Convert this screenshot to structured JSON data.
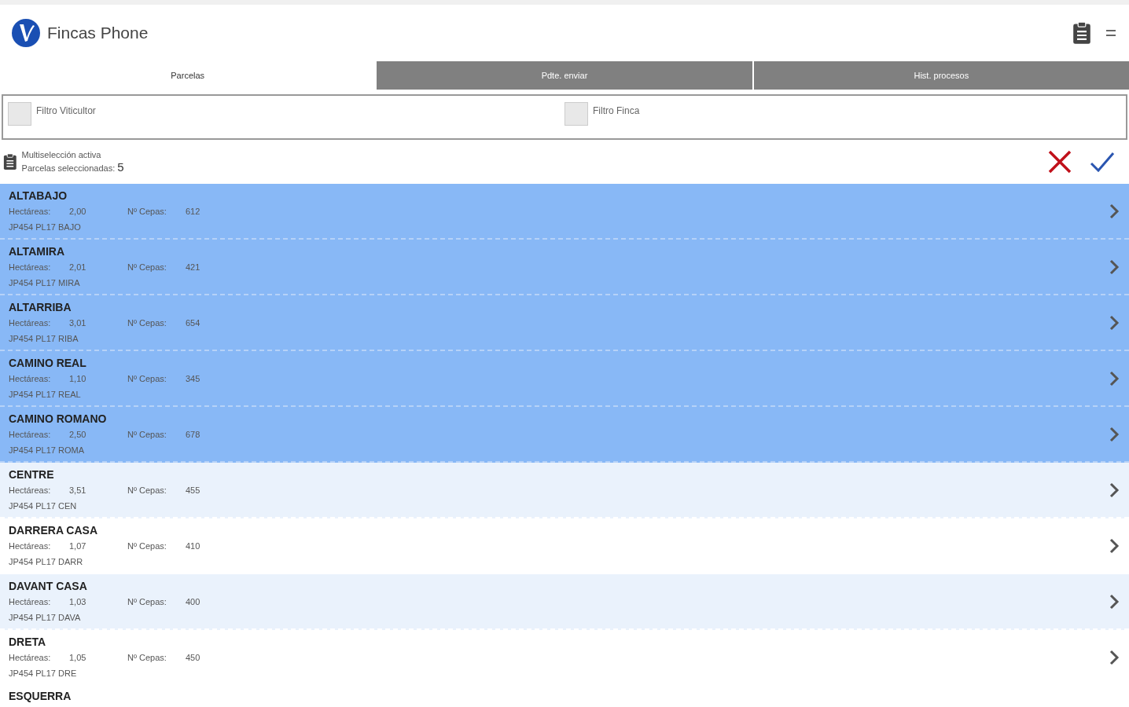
{
  "app": {
    "title": "Fincas Phone"
  },
  "tabs": [
    {
      "label": "Parcelas",
      "selected": true
    },
    {
      "label": "Pdte. enviar",
      "selected": false
    },
    {
      "label": "Hist. procesos",
      "selected": false
    }
  ],
  "filters": [
    {
      "label": "Filtro Viticultor",
      "checked": false
    },
    {
      "label": "Filtro Finca",
      "checked": false
    }
  ],
  "selection_bar": {
    "line_1": "Multiselección activa",
    "label": "Parcelas seleccionadas:",
    "count": "5"
  },
  "parcels": [
    {
      "name": "ALTABAJO",
      "hectares_label": "Hectáreas:",
      "hectares": "2,00",
      "vines_label": "Nº Cepas:",
      "vines": "612",
      "code": "JP454 PL17 BAJO",
      "selected": true
    },
    {
      "name": "ALTAMIRA",
      "hectares_label": "Hectáreas:",
      "hectares": "2,01",
      "vines_label": "Nº Cepas:",
      "vines": "421",
      "code": "JP454 PL17 MIRA",
      "selected": true
    },
    {
      "name": "ALTARRIBA",
      "hectares_label": "Hectáreas:",
      "hectares": "3,01",
      "vines_label": "Nº Cepas:",
      "vines": "654",
      "code": "JP454 PL17 RIBA",
      "selected": true
    },
    {
      "name": "CAMINO REAL",
      "hectares_label": "Hectáreas:",
      "hectares": "1,10",
      "vines_label": "Nº Cepas:",
      "vines": "345",
      "code": "JP454 PL17 REAL",
      "selected": true
    },
    {
      "name": "CAMINO ROMANO",
      "hectares_label": "Hectáreas:",
      "hectares": "2,50",
      "vines_label": "Nº Cepas:",
      "vines": "678",
      "code": "JP454 PL17 ROMA",
      "selected": true
    },
    {
      "name": "CENTRE",
      "hectares_label": "Hectáreas:",
      "hectares": "3,51",
      "vines_label": "Nº Cepas:",
      "vines": "455",
      "code": "JP454 PL17 CEN",
      "selected": false
    },
    {
      "name": "DARRERA CASA",
      "hectares_label": "Hectáreas:",
      "hectares": "1,07",
      "vines_label": "Nº Cepas:",
      "vines": "410",
      "code": "JP454 PL17 DARR",
      "selected": false
    },
    {
      "name": "DAVANT CASA",
      "hectares_label": "Hectáreas:",
      "hectares": "1,03",
      "vines_label": "Nº Cepas:",
      "vines": "400",
      "code": "JP454 PL17 DAVA",
      "selected": false
    },
    {
      "name": "DRETA",
      "hectares_label": "Hectáreas:",
      "hectares": "1,05",
      "vines_label": "Nº Cepas:",
      "vines": "450",
      "code": "JP454 PL17 DRE",
      "selected": false
    }
  ],
  "partial_parcel": {
    "name": "ESQUERRA"
  }
}
